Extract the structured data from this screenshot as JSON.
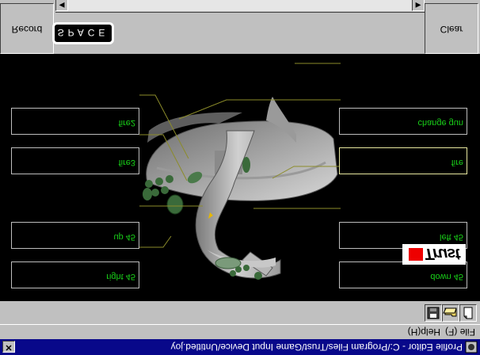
{
  "window": {
    "title": "Profile Editor - C:/Program Files/Trust/Game Input Device/Untitled.joy",
    "close_glyph": "✕"
  },
  "menu": {
    "items": [
      "File (F)",
      "Help(H)"
    ]
  },
  "toolbar": {
    "buttons": [
      "new-file-icon",
      "open-folder-icon",
      "save-disk-icon"
    ]
  },
  "assignments": {
    "left": [
      {
        "label": "right 45"
      },
      {
        "label": "up 45"
      },
      {
        "label": "fire3"
      },
      {
        "label": "fire2"
      }
    ],
    "right": [
      {
        "label": "down 45"
      },
      {
        "label": "left 45"
      },
      {
        "label": "fire"
      },
      {
        "label": "change gun"
      }
    ],
    "selected": "fire"
  },
  "logo": {
    "text": "Trust"
  },
  "controls": {
    "clear_label": "Clear",
    "record_label": "Record",
    "key_display": "SPACE"
  },
  "colors": {
    "label_text": "#19d119",
    "leader_line": "#8c8c2a",
    "title_bar": "#08088a",
    "chrome": "#c0c0c0"
  }
}
